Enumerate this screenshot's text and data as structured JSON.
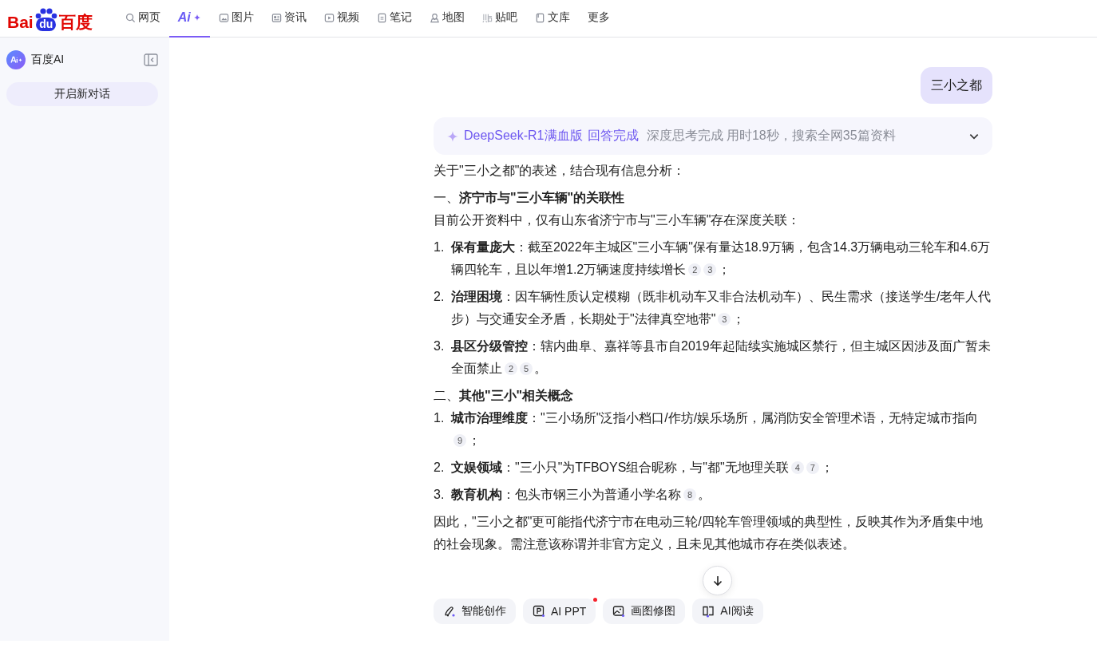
{
  "nav": {
    "logo": {
      "left": "Bai",
      "paw": "du",
      "right": "百度"
    },
    "tabs": [
      {
        "label": "网页",
        "selected": false
      },
      {
        "label": "Ai",
        "selected": true
      },
      {
        "label": "图片",
        "selected": false
      },
      {
        "label": "资讯",
        "selected": false
      },
      {
        "label": "视频",
        "selected": false
      },
      {
        "label": "笔记",
        "selected": false
      },
      {
        "label": "地图",
        "selected": false
      },
      {
        "label": "贴吧",
        "selected": false
      },
      {
        "label": "文库",
        "selected": false
      },
      {
        "label": "更多",
        "selected": false
      }
    ]
  },
  "sidebar": {
    "brand": "百度AI",
    "new_chat": "开启新对话"
  },
  "chat": {
    "user_message": "三小之都",
    "status": {
      "model": "DeepSeek-R1满血版",
      "state": "回答完成",
      "detail": "深度思考完成 用时18秒，搜索全网35篇资料",
      "expanded": false
    },
    "answer": [
      {
        "kind": "paragraph",
        "text": "关于\"三小之都\"的表述，结合现有信息分析："
      },
      {
        "kind": "heading",
        "text": "一、**济宁市与\"三小车辆\"的关联性**"
      },
      {
        "kind": "paragraph",
        "text": "目前公开资料中，仅有山东省济宁市与\"三小车辆\"存在深度关联："
      },
      {
        "kind": "item",
        "number": "1.",
        "text": "**保有量庞大**：截至2022年主城区\"三小车辆\"保有量达18.9万辆，包含14.3万辆电动三轮车和4.6万辆四轮车，且以年增1.2万辆速度持续增长",
        "citations": [
          "2",
          "3"
        ],
        "tail": "；"
      },
      {
        "kind": "item",
        "number": "2.",
        "text": "**治理困境**：因车辆性质认定模糊（既非机动车又非合法机动车）、民生需求（接送学生/老年人代步）与交通安全矛盾，长期处于\"法律真空地带\"",
        "citations": [
          "3"
        ],
        "tail": "；"
      },
      {
        "kind": "item",
        "number": "3.",
        "text": "**县区分级管控**：辖内曲阜、嘉祥等县市自2019年起陆续实施城区禁行，但主城区因涉及面广暂未全面禁止",
        "citations": [
          "2",
          "5"
        ],
        "tail": "。"
      },
      {
        "kind": "heading",
        "text": "二、**其他\"三小\"相关概念**"
      },
      {
        "kind": "item",
        "number": "1.",
        "text": "**城市治理维度**：\"三小场所\"泛指小档口/作坊/娱乐场所，属消防安全管理术语，无特定城市指向",
        "citations": [
          "9"
        ],
        "tail": "；"
      },
      {
        "kind": "item",
        "number": "2.",
        "text": "**文娱领域**：\"三小只\"为TFBOYS组合昵称，与\"都\"无地理关联",
        "citations": [
          "4",
          "7"
        ],
        "tail": "；"
      },
      {
        "kind": "item",
        "number": "3.",
        "text": "**教育机构**：包头市钢三小为普通小学名称",
        "citations": [
          "8"
        ],
        "tail": "。"
      },
      {
        "kind": "paragraph",
        "text": "因此，\"三小之都\"更可能指代济宁市在电动三轮/四轮车管理领域的典型性，反映其作为矛盾集中地的社会现象。需注意该称谓并非官方定义，且未见其他城市存在类似表述。"
      }
    ]
  },
  "tools": [
    {
      "label": "智能创作",
      "new": false
    },
    {
      "label": "AI PPT",
      "new": true
    },
    {
      "label": "画图修图",
      "new": false
    },
    {
      "label": "AI阅读",
      "new": false
    }
  ]
}
